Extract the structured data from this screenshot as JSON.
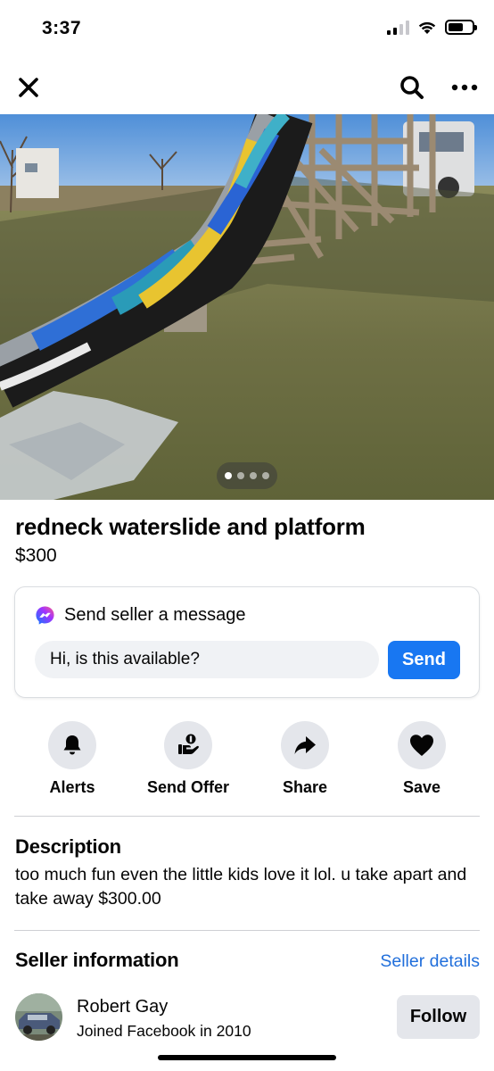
{
  "status_bar": {
    "time": "3:37",
    "icons": [
      "signal-icon",
      "wifi-icon",
      "battery-icon"
    ]
  },
  "nav": {
    "close_icon": "close-icon",
    "search_icon": "search-icon",
    "more_icon": "more-icon"
  },
  "photo": {
    "description_icon": "listing-photo",
    "page_count": 4,
    "active_page": 1
  },
  "listing": {
    "title": "redneck waterslide and platform",
    "price": "$300"
  },
  "message": {
    "heading": "Send seller a message",
    "input_value": "Hi, is this available?",
    "send_label": "Send",
    "accent": "#1877f2"
  },
  "actions": [
    {
      "label": "Alerts",
      "icon": "bell-icon"
    },
    {
      "label": "Send Offer",
      "icon": "offer-icon"
    },
    {
      "label": "Share",
      "icon": "share-icon"
    },
    {
      "label": "Save",
      "icon": "heart-icon"
    }
  ],
  "description": {
    "heading": "Description",
    "text": "too much fun even the little kids love it lol. u take apart and take away $300.00"
  },
  "seller": {
    "heading": "Seller information",
    "details_link": "Seller details",
    "name": "Robert Gay",
    "joined": "Joined Facebook in 2010",
    "follow_label": "Follow",
    "link_color": "#216fdb"
  }
}
